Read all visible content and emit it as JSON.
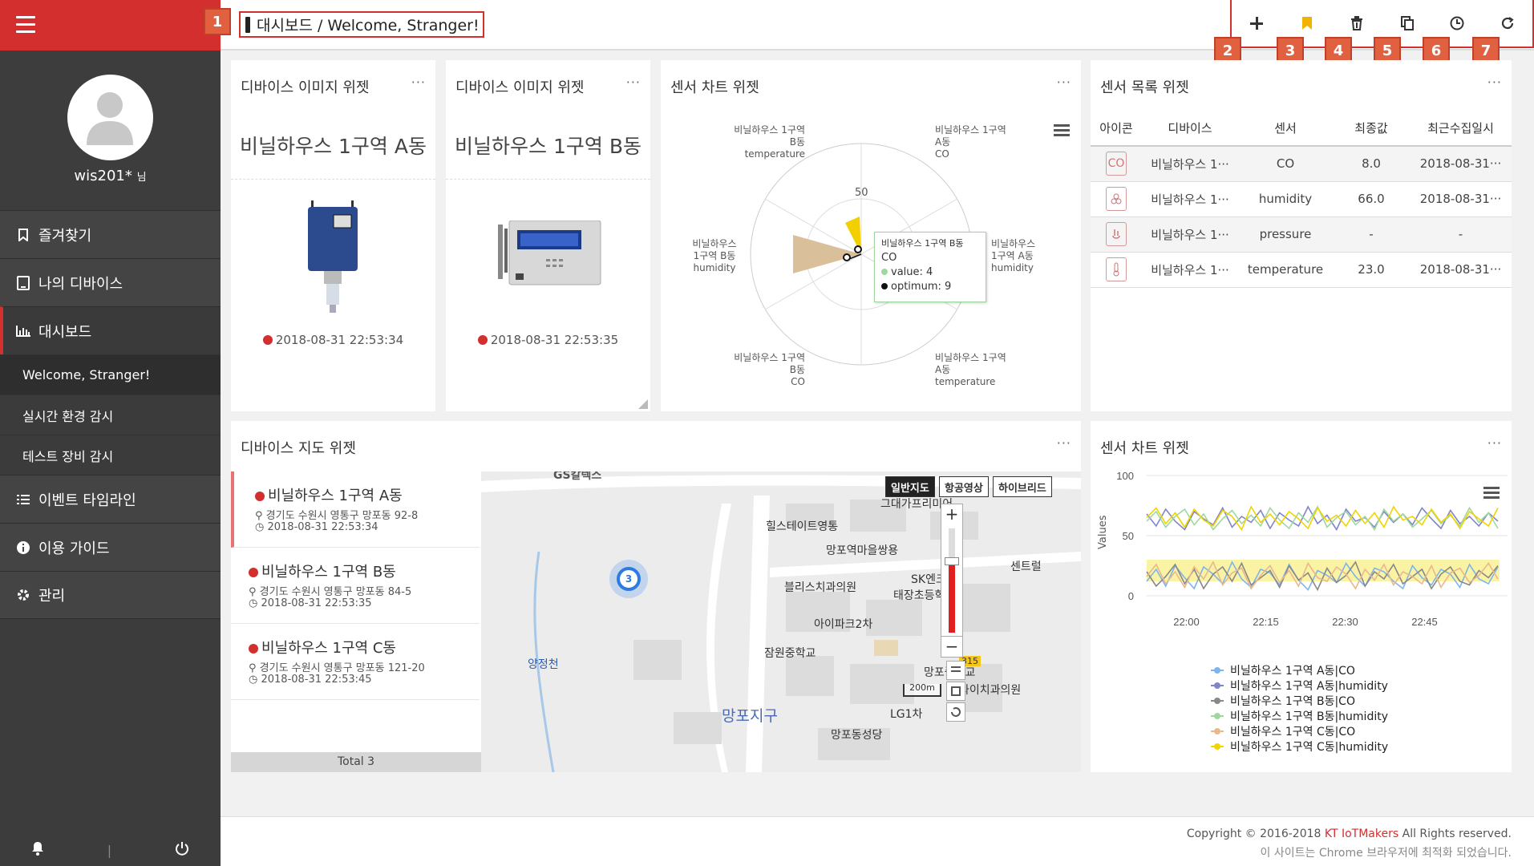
{
  "sidebar": {
    "username": "wis201*",
    "username_suffix": "님",
    "menu": [
      {
        "label": "즐겨찾기",
        "icon": "bookmark-icon"
      },
      {
        "label": "나의 디바이스",
        "icon": "tablet-icon"
      },
      {
        "label": "대시보드",
        "icon": "bar-chart-icon"
      },
      {
        "label": "이벤트 타임라인",
        "icon": "list-icon"
      },
      {
        "label": "이용 가이드",
        "icon": "info-icon"
      },
      {
        "label": "관리",
        "icon": "gear-icon"
      }
    ],
    "submenu": [
      "Welcome, Stranger!",
      "실시간 환경 감시",
      "테스트 장비 감시"
    ],
    "bottom_separator": "|"
  },
  "header": {
    "breadcrumb": "대시보드 / Welcome, Stranger!",
    "annotations": [
      "1",
      "2",
      "3",
      "4",
      "5",
      "6",
      "7"
    ],
    "tools": [
      "plus-icon",
      "bookmark-icon",
      "trash-icon",
      "copy-icon",
      "clock-icon",
      "refresh-icon"
    ]
  },
  "widgets": {
    "device_image_1": {
      "title": "디바이스 이미지 위젯",
      "more": "···",
      "device": "비닐하우스 1구역 A동",
      "timestamp": "2018-08-31 22:53:34"
    },
    "device_image_2": {
      "title": "디바이스 이미지 위젯",
      "more": "···",
      "device": "비닐하우스 1구역 B동",
      "timestamp": "2018-08-31 22:53:35"
    },
    "radar_chart": {
      "title": "센서 차트 위젯",
      "more": "···",
      "axis_labels": [
        [
          "비닐하우스 1구역",
          "A동",
          "CO"
        ],
        [
          "비닐하우스",
          "1구역 A동",
          "humidity"
        ],
        [
          "비닐하우스 1구역",
          "A동",
          "temperature"
        ],
        [
          "비닐하우스 1구역",
          "B동",
          "CO"
        ],
        [
          "비닐하우스",
          "1구역 B동",
          "humidity"
        ],
        [
          "비닐하우스 1구역",
          "B동",
          "temperature"
        ]
      ],
      "ring_label": "50",
      "tooltip": {
        "title": "비닐하우스 1구역 B동",
        "sensor": "CO",
        "value_label": "value: 4",
        "optimum_label": "optimum: 9"
      }
    },
    "sensor_list": {
      "title": "센서 목록 위젯",
      "more": "···",
      "columns": [
        "아이콘",
        "디바이스",
        "센서",
        "최종값",
        "최근수집일시"
      ],
      "rows": [
        {
          "icon": "co-icon",
          "device": "비닐하우스 1···",
          "sensor": "CO",
          "value": "8.0",
          "time": "2018-08-31···"
        },
        {
          "icon": "humidity-icon",
          "device": "비닐하우스 1···",
          "sensor": "humidity",
          "value": "66.0",
          "time": "2018-08-31···"
        },
        {
          "icon": "pressure-icon",
          "device": "비닐하우스 1···",
          "sensor": "pressure",
          "value": "-",
          "time": "-"
        },
        {
          "icon": "thermometer-icon",
          "device": "비닐하우스 1···",
          "sensor": "temperature",
          "value": "23.0",
          "time": "2018-08-31···"
        }
      ]
    },
    "device_map": {
      "title": "디바이스 지도 위젯",
      "more": "···",
      "devices": [
        {
          "name": "비닐하우스 1구역 A동",
          "address": "경기도 수원시 영통구 망포동 92-8",
          "time": "2018-08-31 22:53:34"
        },
        {
          "name": "비닐하우스 1구역 B동",
          "address": "경기도 수원시 영통구 망포동 84-5",
          "time": "2018-08-31 22:53:35"
        },
        {
          "name": "비닐하우스 1구역 C동",
          "address": "경기도 수원시 영통구 망포동 121-20",
          "time": "2018-08-31 22:53:45"
        }
      ],
      "total": "Total 3",
      "map_types": [
        "일반지도",
        "항공영상",
        "하이브리드"
      ],
      "cluster_count": "3",
      "scale": "200m",
      "labels": [
        "GS칼텍스",
        "그대가프리미어",
        "힐스테이트영통",
        "망포역마을쌍용",
        "SK엔크린",
        "블리스치과의원",
        "태장초등학교",
        "센트럴",
        "아이파크2차",
        "잠원중학교",
        "양정천",
        "망포중학교",
        "와이치과의원",
        "망포지구",
        "LG1차",
        "망포동성당",
        "315"
      ],
      "zoom_in": "+",
      "zoom_out": "−"
    },
    "line_chart": {
      "title": "센서 차트 위젯",
      "more": "···"
    }
  },
  "chart_data": {
    "type": "line",
    "ylabel": "Values",
    "ylim": [
      0,
      100
    ],
    "yticks": [
      "100",
      "50",
      "0"
    ],
    "xticks": [
      "22:00",
      "22:15",
      "22:30",
      "22:45"
    ],
    "legend": "bottom",
    "series": [
      {
        "name": "비닐하우스 1구역 A동|CO",
        "color": "#7cb5ec",
        "values": [
          12,
          22,
          8,
          25,
          15,
          6,
          24,
          18,
          10,
          28,
          14,
          7,
          22,
          19,
          9,
          26,
          13,
          5,
          21,
          17,
          11,
          27,
          16,
          8,
          23,
          20,
          12,
          6,
          25,
          15,
          9,
          22,
          18,
          7,
          26,
          14,
          10,
          24
        ]
      },
      {
        "name": "비닐하우스 1구역 A동|humidity",
        "color": "#8085c8",
        "values": [
          68,
          58,
          72,
          62,
          55,
          70,
          64,
          59,
          73,
          57,
          66,
          61,
          71,
          56,
          69,
          63,
          58,
          74,
          60,
          67,
          55,
          72,
          62,
          65,
          57,
          70,
          61,
          68,
          59,
          73,
          64,
          56,
          71,
          60,
          66,
          58,
          69,
          62
        ]
      },
      {
        "name": "비닐하우스 1구역 B동|CO",
        "color": "#888888",
        "values": [
          20,
          8,
          16,
          26,
          10,
          22,
          6,
          18,
          24,
          12,
          27,
          9,
          15,
          21,
          7,
          25,
          13,
          19,
          5,
          23,
          11,
          17,
          28,
          8,
          20,
          14,
          26,
          10,
          16,
          22,
          6,
          18,
          24,
          12,
          9,
          21,
          15,
          25
        ]
      },
      {
        "name": "비닐하우스 1구역 B동|humidity",
        "color": "#9fd89f",
        "values": [
          62,
          70,
          57,
          66,
          72,
          59,
          68,
          55,
          64,
          71,
          60,
          67,
          58,
          73,
          63,
          56,
          69,
          61,
          74,
          57,
          65,
          70,
          59,
          66,
          55,
          72,
          62,
          68,
          57,
          64,
          71,
          60,
          67,
          58,
          73,
          61,
          69,
          56
        ]
      },
      {
        "name": "비닐하우스 1구역 C동|CO",
        "color": "#e9b88d",
        "values": [
          16,
          26,
          10,
          20,
          7,
          24,
          14,
          28,
          9,
          19,
          23,
          6,
          17,
          25,
          11,
          21,
          8,
          27,
          15,
          12,
          24,
          18,
          6,
          22,
          13,
          26,
          9,
          20,
          16,
          10,
          25,
          7,
          19,
          23,
          11,
          17,
          27,
          14
        ]
      },
      {
        "name": "비닐하우스 1구역 C동|humidity",
        "color": "#f1d400",
        "values": [
          65,
          73,
          60,
          69,
          57,
          72,
          63,
          58,
          71,
          66,
          55,
          74,
          61,
          68,
          59,
          70,
          64,
          56,
          73,
          62,
          67,
          58,
          71,
          60,
          69,
          57,
          74,
          63,
          66,
          59,
          72,
          61,
          68,
          56,
          70,
          64,
          58,
          73
        ]
      }
    ]
  },
  "footer": {
    "copyright_pre": "Copyright © 2016-2018 ",
    "brand": "KT IoTMakers",
    "copyright_post": " All Rights reserved.",
    "note": "이 사이트는 Chrome 브라우저에 최적화 되었습니다."
  }
}
